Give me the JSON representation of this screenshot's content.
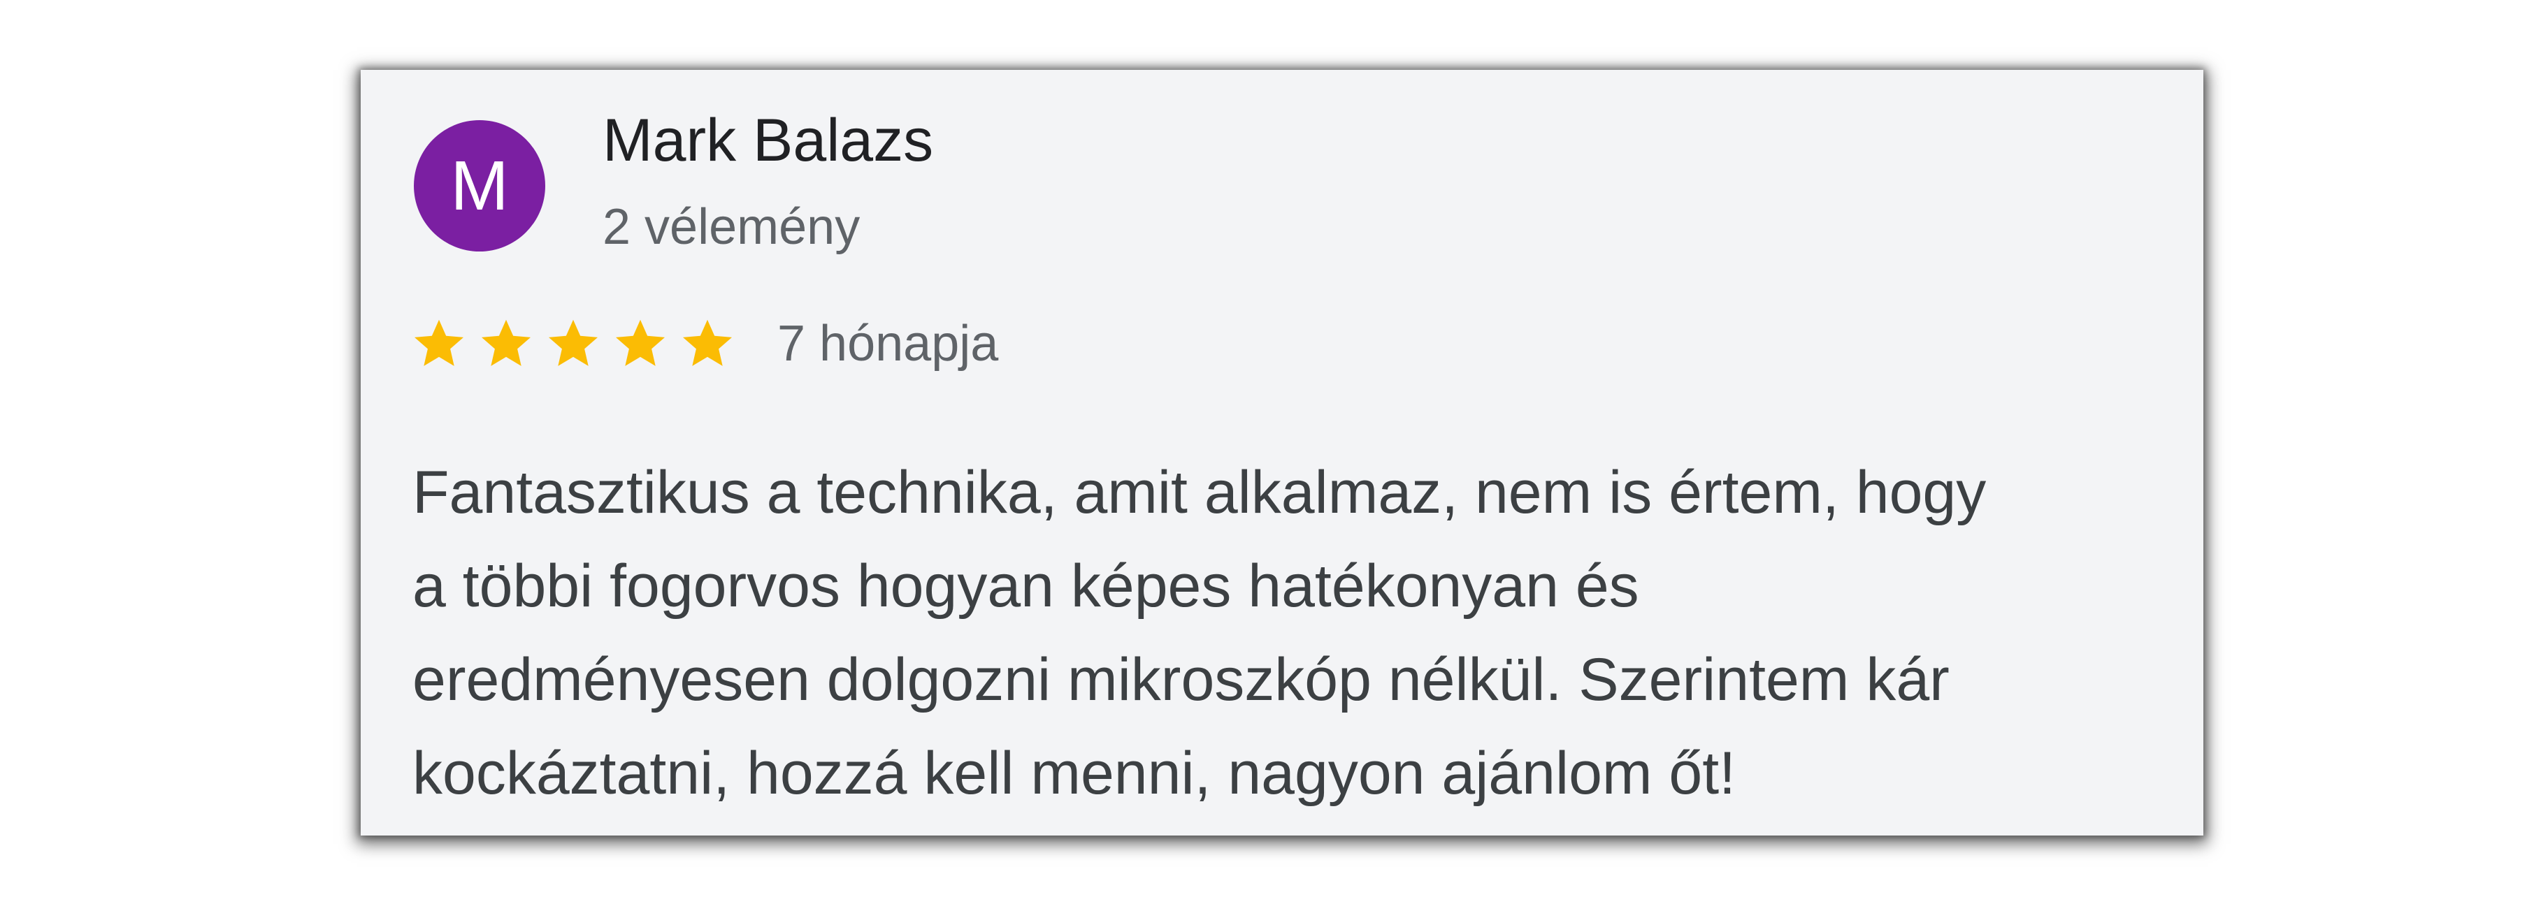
{
  "review": {
    "author": {
      "initial": "M",
      "name": "Mark Balazs",
      "review_count": "2 vélemény",
      "avatar_color": "#7b1fa2"
    },
    "rating": {
      "stars": 5,
      "max": 5,
      "star_color": "#fbbc04"
    },
    "time": "7 hónapja",
    "text": "Fantasztikus a technika, amit alkalmaz, nem is értem, hogy\na többi fogorvos hogyan képes hatékonyan és\neredményesen dolgozni mikroszkóp nélkül. Szerintem kár\nkockáztatni, hozzá kell menni, nagyon ajánlom őt!"
  }
}
